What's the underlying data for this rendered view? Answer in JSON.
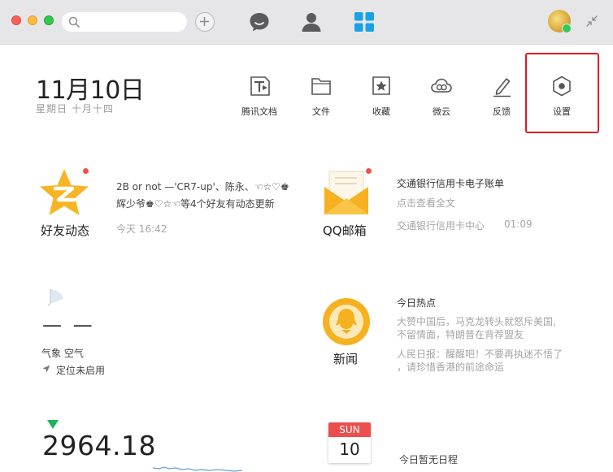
{
  "toolbar": {
    "search_placeholder": "",
    "nav_icons": [
      "chat-bubble-icon",
      "contact-person-icon",
      "apps-grid-icon"
    ]
  },
  "header": {
    "date": "11月10日",
    "lunar": "星期日  十月十四",
    "tools": [
      {
        "label": "腾讯文档",
        "icon": "tencent-docs-icon"
      },
      {
        "label": "文件",
        "icon": "folder-icon"
      },
      {
        "label": "收藏",
        "icon": "favorites-star-icon"
      },
      {
        "label": "微云",
        "icon": "weiyun-cloud-icon"
      },
      {
        "label": "反馈",
        "icon": "feedback-pencil-icon"
      },
      {
        "label": "设置",
        "icon": "settings-hexagon-icon"
      }
    ]
  },
  "cards": {
    "friends": {
      "title": "好友动态",
      "line1": "2B or not —'CR7-up'、陈永、☜☆♡♚",
      "line2": "辉少爷♚♡☆☜等4个好友有动态更新",
      "time": "今天 16:42"
    },
    "mail": {
      "title": "QQ邮箱",
      "subject": "交通银行信用卡电子账单",
      "hint": "点击查看全文",
      "sender": "交通银行信用卡中心",
      "time": "01:09"
    },
    "weather": {
      "temp": "— —",
      "labels": "气象    空气",
      "location": "定位未启用"
    },
    "news": {
      "title": "新闻",
      "heading": "今日热点",
      "item1_line1": "大赞中国后，马克龙转头就怒斥美国,",
      "item1_line2": "不留情面，特朗普在背荐盟友",
      "item2_line1": "人民日报：醒醒吧！不要再执迷不悟了",
      "item2_line2": "，请珍惜香港的前途命运"
    },
    "stock": {
      "value": "2964.18",
      "trend": "down",
      "color": "#1fb35a"
    },
    "schedule": {
      "month": "SUN",
      "day": "10",
      "empty": "今日暂无日程"
    }
  },
  "colors": {
    "accent_blue": "#1aa1e5",
    "highlight_red": "#e01b24",
    "qq_yellow": "#f5b120"
  }
}
